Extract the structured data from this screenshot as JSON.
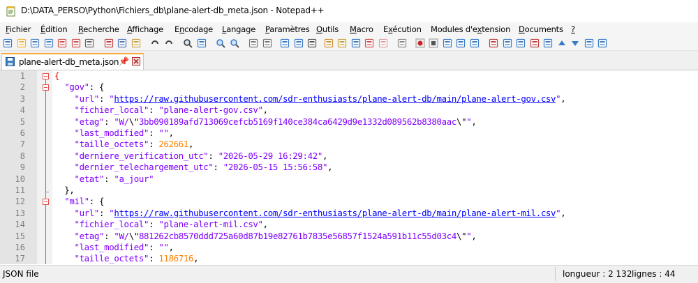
{
  "window": {
    "title": "D:\\DATA_PERSO\\Python\\Fichiers_db\\plane-alert-db_meta.json - Notepad++"
  },
  "menu": {
    "items": [
      {
        "pre": "",
        "acc": "F",
        "post": "ichier"
      },
      {
        "pre": "",
        "acc": "É",
        "post": "dition"
      },
      {
        "pre": "",
        "acc": "R",
        "post": "echerche"
      },
      {
        "pre": "",
        "acc": "A",
        "post": "ffichage"
      },
      {
        "pre": "E",
        "acc": "n",
        "post": "codage"
      },
      {
        "pre": "",
        "acc": "L",
        "post": "angage"
      },
      {
        "pre": "",
        "acc": "P",
        "post": "aramètres"
      },
      {
        "pre": "",
        "acc": "O",
        "post": "utils"
      },
      {
        "pre": "",
        "acc": "M",
        "post": "acro"
      },
      {
        "pre": "E",
        "acc": "x",
        "post": "écution"
      },
      {
        "pre": "Modules d'e",
        "acc": "x",
        "post": "tension"
      },
      {
        "pre": "",
        "acc": "D",
        "post": "ocuments"
      },
      {
        "pre": "",
        "acc": "?",
        "post": ""
      }
    ]
  },
  "toolbar": {
    "icons": [
      "new-file-icon",
      "open-file-icon",
      "save-icon",
      "save-all-icon",
      "close-icon",
      "close-all-icon",
      "print-icon",
      "cut-icon",
      "copy-icon",
      "paste-icon",
      "undo-icon",
      "redo-icon",
      "find-icon",
      "replace-icon",
      "zoom-in-icon",
      "zoom-out-icon",
      "sync-vertical-icon",
      "sync-horizontal-icon",
      "word-wrap-icon",
      "show-all-chars-icon",
      "indent-guide-icon",
      "user-lang-icon",
      "doc-map-icon",
      "function-list-icon",
      "folder-workspace-icon",
      "doc-list-icon",
      "monitor-icon",
      "record-macro-icon",
      "stop-record-icon",
      "play-macro-icon",
      "run-macro-multiple-icon",
      "save-macro-icon",
      "plugin-1-icon",
      "plugin-2-icon",
      "plugin-3-icon",
      "plugin-4-icon",
      "plugin-5-icon",
      "arrow-up-icon",
      "arrow-down-icon",
      "plugin-6-icon",
      "plugin-7-icon"
    ],
    "colors": {
      "accent": "#fbaa3a",
      "brace": "#e00000",
      "string": "#8000ff",
      "number": "#ff8000",
      "url": "#0000ff"
    }
  },
  "tab": {
    "label": "plane-alert-db_meta.json",
    "pin": "📌",
    "close": "×"
  },
  "editor": {
    "lines": [
      {
        "n": "1",
        "segs": [
          [
            "brace",
            "{"
          ]
        ]
      },
      {
        "n": "2",
        "segs": [
          [
            "punc",
            "  "
          ],
          [
            "key",
            "\"gov\""
          ],
          [
            "punc",
            ": {"
          ]
        ]
      },
      {
        "n": "3",
        "segs": [
          [
            "punc",
            "    "
          ],
          [
            "key",
            "\"url\""
          ],
          [
            "punc",
            ": "
          ],
          [
            "str",
            "\""
          ],
          [
            "url",
            "https://raw.githubusercontent.com/sdr-enthusiasts/plane-alert-db/main/plane-alert-gov.csv"
          ],
          [
            "str",
            "\""
          ],
          [
            "punc",
            ","
          ]
        ]
      },
      {
        "n": "4",
        "segs": [
          [
            "punc",
            "    "
          ],
          [
            "key",
            "\"fichier_local\""
          ],
          [
            "punc",
            ": "
          ],
          [
            "str",
            "\"plane-alert-gov.csv\""
          ],
          [
            "punc",
            ","
          ]
        ]
      },
      {
        "n": "5",
        "segs": [
          [
            "punc",
            "    "
          ],
          [
            "key",
            "\"etag\""
          ],
          [
            "punc",
            ": "
          ],
          [
            "str",
            "\"W/"
          ],
          [
            "esc",
            "\\\""
          ],
          [
            "str",
            "3bb090189afd713069cefcb5169f140ce384ca6429d9e1332d089562b8380aac"
          ],
          [
            "esc",
            "\\\""
          ],
          [
            "str",
            "\""
          ],
          [
            "punc",
            ","
          ]
        ]
      },
      {
        "n": "6",
        "segs": [
          [
            "punc",
            "    "
          ],
          [
            "key",
            "\"last_modified\""
          ],
          [
            "punc",
            ": "
          ],
          [
            "str",
            "\"\""
          ],
          [
            "punc",
            ","
          ]
        ]
      },
      {
        "n": "7",
        "segs": [
          [
            "punc",
            "    "
          ],
          [
            "key",
            "\"taille_octets\""
          ],
          [
            "punc",
            ": "
          ],
          [
            "num",
            "262661"
          ],
          [
            "punc",
            ","
          ]
        ]
      },
      {
        "n": "8",
        "segs": [
          [
            "punc",
            "    "
          ],
          [
            "key",
            "\"derniere_verification_utc\""
          ],
          [
            "punc",
            ": "
          ],
          [
            "str",
            "\"2026-05-29 16:29:42\""
          ],
          [
            "punc",
            ","
          ]
        ]
      },
      {
        "n": "9",
        "segs": [
          [
            "punc",
            "    "
          ],
          [
            "key",
            "\"dernier_telechargement_utc\""
          ],
          [
            "punc",
            ": "
          ],
          [
            "str",
            "\"2026-05-15 15:56:58\""
          ],
          [
            "punc",
            ","
          ]
        ]
      },
      {
        "n": "10",
        "segs": [
          [
            "punc",
            "    "
          ],
          [
            "key",
            "\"etat\""
          ],
          [
            "punc",
            ": "
          ],
          [
            "str",
            "\"a_jour\""
          ]
        ]
      },
      {
        "n": "11",
        "segs": [
          [
            "punc",
            "  },"
          ]
        ]
      },
      {
        "n": "12",
        "segs": [
          [
            "punc",
            "  "
          ],
          [
            "key",
            "\"mil\""
          ],
          [
            "punc",
            ": {"
          ]
        ]
      },
      {
        "n": "13",
        "segs": [
          [
            "punc",
            "    "
          ],
          [
            "key",
            "\"url\""
          ],
          [
            "punc",
            ": "
          ],
          [
            "str",
            "\""
          ],
          [
            "url",
            "https://raw.githubusercontent.com/sdr-enthusiasts/plane-alert-db/main/plane-alert-mil.csv"
          ],
          [
            "str",
            "\""
          ],
          [
            "punc",
            ","
          ]
        ]
      },
      {
        "n": "14",
        "segs": [
          [
            "punc",
            "    "
          ],
          [
            "key",
            "\"fichier_local\""
          ],
          [
            "punc",
            ": "
          ],
          [
            "str",
            "\"plane-alert-mil.csv\""
          ],
          [
            "punc",
            ","
          ]
        ]
      },
      {
        "n": "15",
        "segs": [
          [
            "punc",
            "    "
          ],
          [
            "key",
            "\"etag\""
          ],
          [
            "punc",
            ": "
          ],
          [
            "str",
            "\"W/"
          ],
          [
            "esc",
            "\\\""
          ],
          [
            "str",
            "881262cb8570ddd725a60d87b19e82761b7835e56857f1524a591b11c55d03c4"
          ],
          [
            "esc",
            "\\\""
          ],
          [
            "str",
            "\""
          ],
          [
            "punc",
            ","
          ]
        ]
      },
      {
        "n": "16",
        "segs": [
          [
            "punc",
            "    "
          ],
          [
            "key",
            "\"last_modified\""
          ],
          [
            "punc",
            ": "
          ],
          [
            "str",
            "\"\""
          ],
          [
            "punc",
            ","
          ]
        ]
      },
      {
        "n": "17",
        "segs": [
          [
            "punc",
            "    "
          ],
          [
            "key",
            "\"taille_octets\""
          ],
          [
            "punc",
            ": "
          ],
          [
            "num",
            "1186716"
          ],
          [
            "punc",
            ","
          ]
        ]
      }
    ]
  },
  "status": {
    "file_type": "JSON file",
    "length": "longueur : 2 132",
    "lines": "lignes : 44"
  }
}
